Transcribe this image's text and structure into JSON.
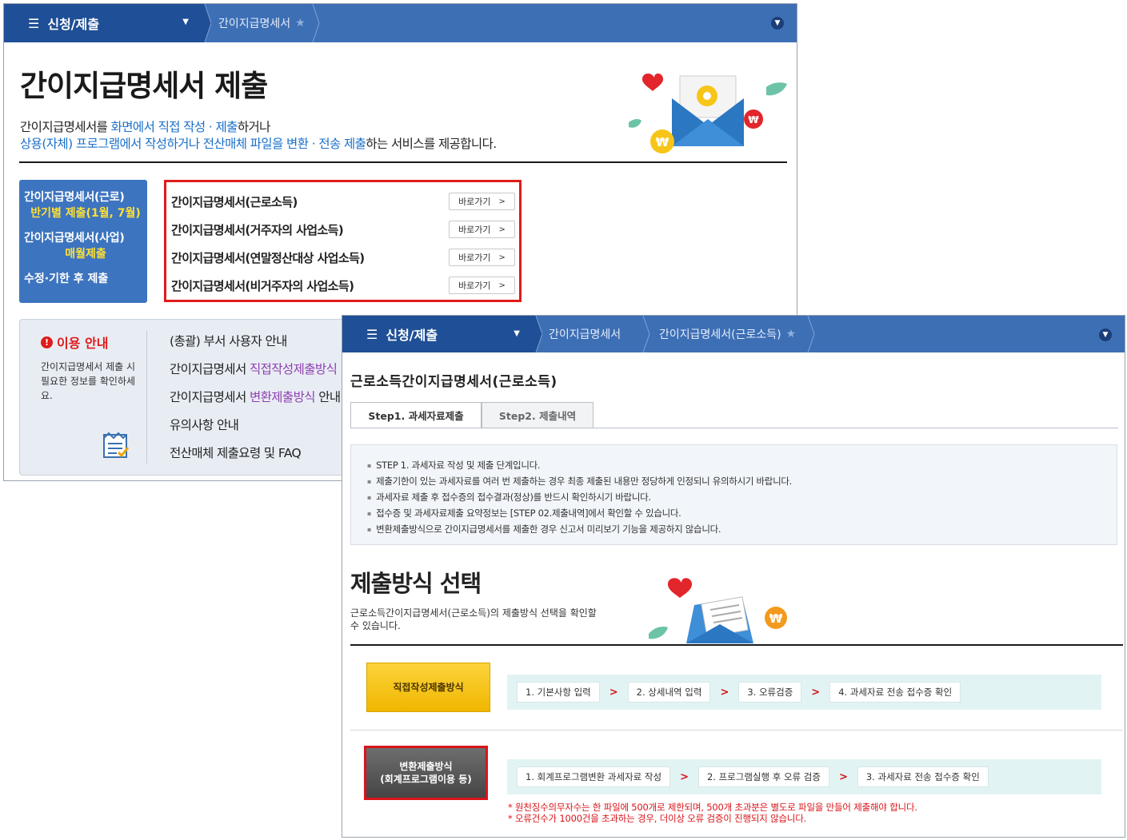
{
  "win1": {
    "nav": {
      "menu_label": "신청/제출",
      "breadcrumb": [
        "간이지급명세서"
      ]
    },
    "title": "간이지급명세서 제출",
    "desc": {
      "l1a": "간이지급명세서를 ",
      "l1b": "화면에서 직접 작성 · 제출",
      "l1c": "하거나",
      "l2a": "상용(자체) 프로그램에서 작성하거나 전산매체 파일을 변환 · 전송 제출",
      "l2b": "하는 서비스를 제공합니다."
    },
    "leftnav": {
      "item1": "간이지급명세서(근로)",
      "item1_sub": "반기별 제출(1월, 7월)",
      "item2": "간이지급명세서(사업)",
      "item2_sub": "매월제출",
      "item3": "수정·기한 후 제출"
    },
    "shortcuts": [
      {
        "label": "간이지급명세서(근로소득)",
        "button": "바로가기"
      },
      {
        "label": "간이지급명세서(거주자의 사업소득)",
        "button": "바로가기"
      },
      {
        "label": "간이지급명세서(연말정산대상 사업소득)",
        "button": "바로가기"
      },
      {
        "label": "간이지급명세서(비거주자의 사업소득)",
        "button": "바로가기"
      }
    ],
    "guide": {
      "title": "이용 안내",
      "desc": "간이지급명세서 제출 시 필요한 정보를 확인하세요.",
      "items": {
        "i1": "(총괄) 부서 사용자 안내",
        "i2a": "간이지급명세서 ",
        "i2b": "직접작성제출방식",
        "i3a": "간이지급명세서 ",
        "i3b": "변환제출방식",
        "i3c": " 안내",
        "i4": "유의사항 안내",
        "i5": "전산매체 제출요령 및 FAQ"
      }
    }
  },
  "win2": {
    "nav": {
      "menu_label": "신청/제출",
      "breadcrumb": [
        "간이지급명세서",
        "간이지급명세서(근로소득)"
      ]
    },
    "title": "근로소득간이지급명세서(근로소득)",
    "tabs": [
      "Step1. 과세자료제출",
      "Step2. 제출내역"
    ],
    "notices": [
      "STEP 1. 과세자료 작성 및 제출 단계입니다.",
      "제출기한이 있는 과세자료를 여러 번 제출하는 경우 최종 제출된 내용만 정당하게 인정되니 유의하시기 바랍니다.",
      "과세자료 제출 후 접수증의 접수결과(정상)를 반드시 확인하시기 바랍니다.",
      "접수증 및 과세자료제출 요약정보는 [STEP 02.제출내역]에서 확인할 수 있습니다.",
      "변환제출방식으로 간이지급명세서를 제출한 경우 신고서 미리보기 기능을 제공하지 않습니다."
    ],
    "section_title": "제출방식 선택",
    "section_desc": "근로소득간이지급명세서(근로소득)의 제출방식 선택을 확인할 수 있습니다.",
    "method1": {
      "label": "직접작성제출방식",
      "steps": [
        "1. 기본사항 입력",
        "2. 상세내역 입력",
        "3. 오류검증",
        "4. 과세자료 전송 접수증 확인"
      ]
    },
    "method2": {
      "label1": "변환제출방식",
      "label2": "(회계프로그램이용 등)",
      "steps": [
        "1. 회계프로그램변환 과세자료 작성",
        "2. 프로그램실행 후 오류 검증",
        "3. 과세자료 전송 접수증 확인"
      ]
    },
    "warnings": [
      "* 원천징수의무자수는 한 파일에 500개로 제한되며, 500개 초과분은 별도로 파일을 만들어 제출해야 합니다.",
      "* 오류건수가 1000건을 초과하는 경우, 더이상 오류 검증이 진행되지 않습니다."
    ]
  },
  "colors": {
    "nav_blue": "#3d6fb5",
    "nav_dark": "#1f4f96",
    "accent_red": "#e01b1b",
    "link_blue": "#1a6fc9",
    "yellow": "#f6c21a"
  }
}
